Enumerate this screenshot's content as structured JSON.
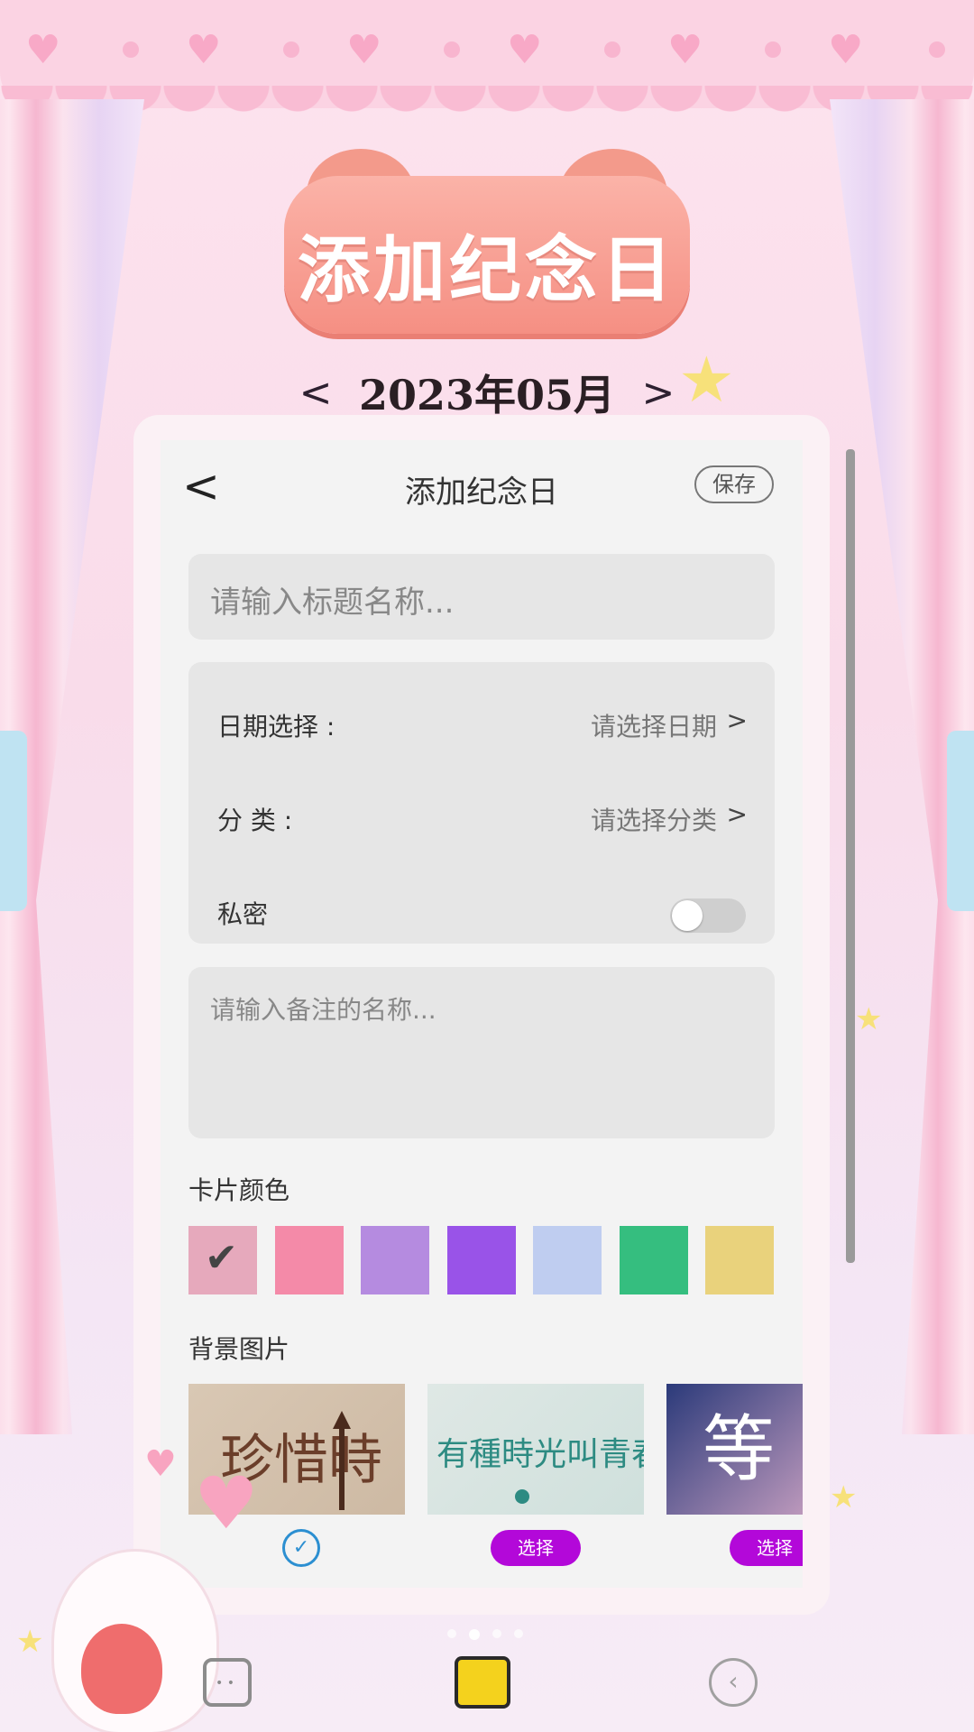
{
  "header": {
    "banner_title": "添加纪念日",
    "month_label": "2023年05月",
    "prev_arrow": "<",
    "next_arrow": ">"
  },
  "topbar": {
    "back": "<",
    "title": "添加纪念日",
    "save_label": "保存"
  },
  "form": {
    "title_placeholder": "请输入标题名称...",
    "date": {
      "label": "日期选择 :",
      "value": "请选择日期",
      "chevron": ">"
    },
    "category": {
      "label": "分 类 :",
      "value": "请选择分类",
      "chevron": ">"
    },
    "private": {
      "label": "私密",
      "enabled": false
    },
    "notes_placeholder": "请输入备注的名称..."
  },
  "card_color": {
    "label": "卡片颜色",
    "swatches": [
      "#e6a9bc",
      "#f48aa8",
      "#b58be0",
      "#9953e8",
      "#bfcdf0",
      "#35be7f",
      "#e9d27c"
    ],
    "selected_index": 0
  },
  "background": {
    "label": "背景图片",
    "cards": [
      {
        "art_text": "珍惜時",
        "state": "selected"
      },
      {
        "art_text": "有種時光叫青春",
        "state": "select",
        "button": "选择"
      },
      {
        "art_text": "等",
        "state": "select",
        "button": "选择"
      }
    ]
  },
  "bottom_nav": {
    "items": [
      "notes-face-icon",
      "edit-icon",
      "back-circle-icon"
    ],
    "active_index": 1
  }
}
